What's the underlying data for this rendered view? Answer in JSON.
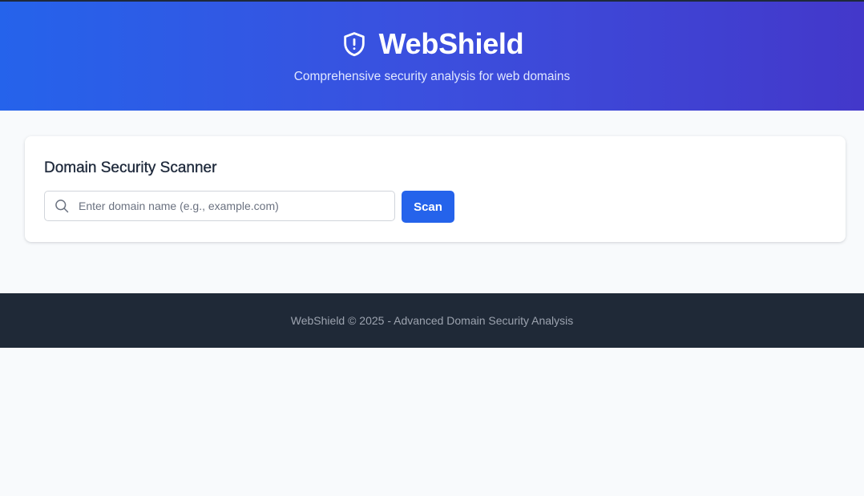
{
  "header": {
    "title": "WebShield",
    "subtitle": "Comprehensive security analysis for web domains",
    "logo_icon": "shield-alert-icon"
  },
  "scanner": {
    "title": "Domain Security Scanner",
    "search_icon": "search-icon",
    "input_placeholder": "Enter domain name (e.g., example.com)",
    "input_value": "",
    "scan_label": "Scan"
  },
  "footer": {
    "text": "WebShield © 2025 - Advanced Domain Security Analysis"
  },
  "colors": {
    "header_gradient_start": "#2563eb",
    "header_gradient_end": "#4338ca",
    "button": "#2563eb",
    "footer_bg": "#1f2937",
    "page_bg": "#f8fafc"
  }
}
